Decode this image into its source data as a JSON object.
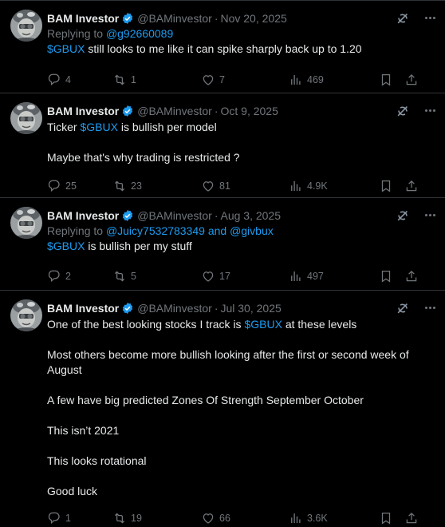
{
  "author": {
    "name": "BAM Investor",
    "handle": "@BAMinvestor"
  },
  "icons": {
    "reply": "reply-icon",
    "retweet": "retweet-icon",
    "like": "heart-icon",
    "views": "views-icon",
    "bookmark": "bookmark-icon",
    "share": "share-icon",
    "grok": "grok-icon",
    "more": "more-icon",
    "verified": "verified-badge-icon"
  },
  "colors": {
    "background": "#000000",
    "text": "#e7e9ea",
    "muted": "#71767b",
    "link": "#1d9bf0",
    "divider": "#2f3336"
  },
  "tweets": [
    {
      "date": "Nov 20, 2025",
      "reply_prefix": "Replying to",
      "reply_to": "@g92660089",
      "reply_to_2": "",
      "reply_and": "",
      "cashtag": "$GBUX",
      "lines": [
        "still looks to me like it can spike sharply back up to 1.20"
      ],
      "replies": "4",
      "retweets": "1",
      "likes": "7",
      "views": "469"
    },
    {
      "date": "Oct 9, 2025",
      "text_before": "Ticker",
      "cashtag": "$GBUX",
      "lines": [
        "is bullish per model",
        "Maybe that's why trading is restricted ?"
      ],
      "replies": "25",
      "retweets": "23",
      "likes": "81",
      "views": "4.9K"
    },
    {
      "date": "Aug 3, 2025",
      "reply_prefix": "Replying to",
      "reply_to": "@Juicy7532783349",
      "reply_and": "and",
      "reply_to_2": "@givbux",
      "cashtag": "$GBUX",
      "lines": [
        "is bullish per my stuff"
      ],
      "replies": "2",
      "retweets": "5",
      "likes": "17",
      "views": "497"
    },
    {
      "date": "Jul 30, 2025",
      "text_before": "One of the best looking stocks I track is",
      "cashtag": "$GBUX",
      "text_after": "at these levels",
      "lines": [
        "Most others become more bullish looking after the first or second week of August",
        "A few have big predicted Zones Of Strength September October",
        "This isn’t 2021",
        "This looks rotational",
        "Good luck"
      ],
      "replies": "1",
      "retweets": "19",
      "likes": "66",
      "views": "3.6K"
    }
  ]
}
